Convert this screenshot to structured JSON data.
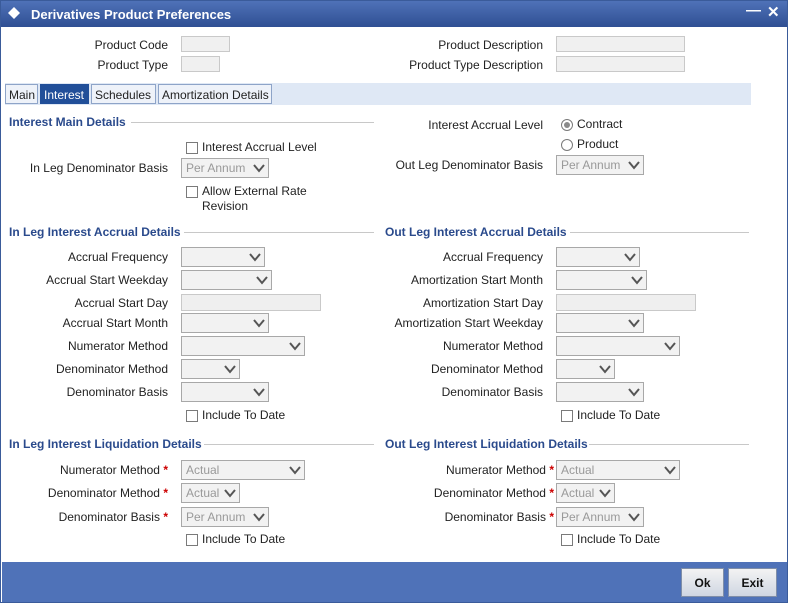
{
  "window": {
    "title": "Derivatives Product Preferences"
  },
  "header": {
    "product_code_label": "Product Code",
    "product_type_label": "Product Type",
    "product_description_label": "Product Description",
    "product_type_description_label": "Product Type Description"
  },
  "tabs": [
    "Main",
    "Interest",
    "Schedules",
    "Amortization Details"
  ],
  "interest_main": {
    "section_title": "Interest Main Details",
    "interest_accrual_level_check": "Interest Accrual Level",
    "in_leg_denominator_basis_label": "In Leg Denominator Basis",
    "in_leg_denominator_basis_value": "Per Annum",
    "allow_external_rate_revision": "Allow External Rate Revision",
    "interest_accrual_level_label": "Interest Accrual Level",
    "radio_contract": "Contract",
    "radio_product": "Product",
    "out_leg_denominator_basis_label": "Out Leg Denominator Basis",
    "out_leg_denominator_basis_value": "Per Annum"
  },
  "in_leg_accrual": {
    "section_title": "In Leg Interest Accrual Details",
    "accrual_frequency": "Accrual Frequency",
    "accrual_start_weekday": "Accrual Start Weekday",
    "accrual_start_day": "Accrual Start Day",
    "accrual_start_month": "Accrual Start Month",
    "numerator_method": "Numerator Method",
    "denominator_method": "Denominator Method",
    "denominator_basis": "Denominator Basis",
    "include_to_date": "Include To Date"
  },
  "out_leg_accrual": {
    "section_title": "Out Leg Interest Accrual Details",
    "accrual_frequency": "Accrual Frequency",
    "amortization_start_month": "Amortization Start Month",
    "amortization_start_day": "Amortization Start Day",
    "amortization_start_weekday": "Amortization Start Weekday",
    "numerator_method": "Numerator Method",
    "denominator_method": "Denominator Method",
    "denominator_basis": "Denominator Basis",
    "include_to_date": "Include To Date"
  },
  "in_leg_liquidation": {
    "section_title": "In Leg Interest Liquidation Details",
    "numerator_method": "Numerator Method",
    "numerator_method_value": "Actual",
    "denominator_method": "Denominator Method",
    "denominator_method_value": "Actual",
    "denominator_basis": "Denominator Basis",
    "denominator_basis_value": "Per Annum",
    "include_to_date": "Include To Date"
  },
  "out_leg_liquidation": {
    "section_title": "Out Leg Interest Liquidation Details",
    "numerator_method": "Numerator Method",
    "numerator_method_value": "Actual",
    "denominator_method": "Denominator Method",
    "denominator_method_value": "Actual",
    "denominator_basis": "Denominator Basis",
    "denominator_basis_value": "Per Annum",
    "include_to_date": "Include To Date"
  },
  "required_marker": "*",
  "footer": {
    "ok": "Ok",
    "exit": "Exit"
  },
  "icons": {
    "window": "diamond-icon",
    "minimize": "minimize-icon",
    "close": "close-icon",
    "dropdown": "chevron-down-icon"
  },
  "colors": {
    "titlebar": "#3a5ea6",
    "section_title": "#2a4a8c",
    "active_tab": "#214f99",
    "footer": "#4f72b8",
    "required": "#cc0000"
  }
}
